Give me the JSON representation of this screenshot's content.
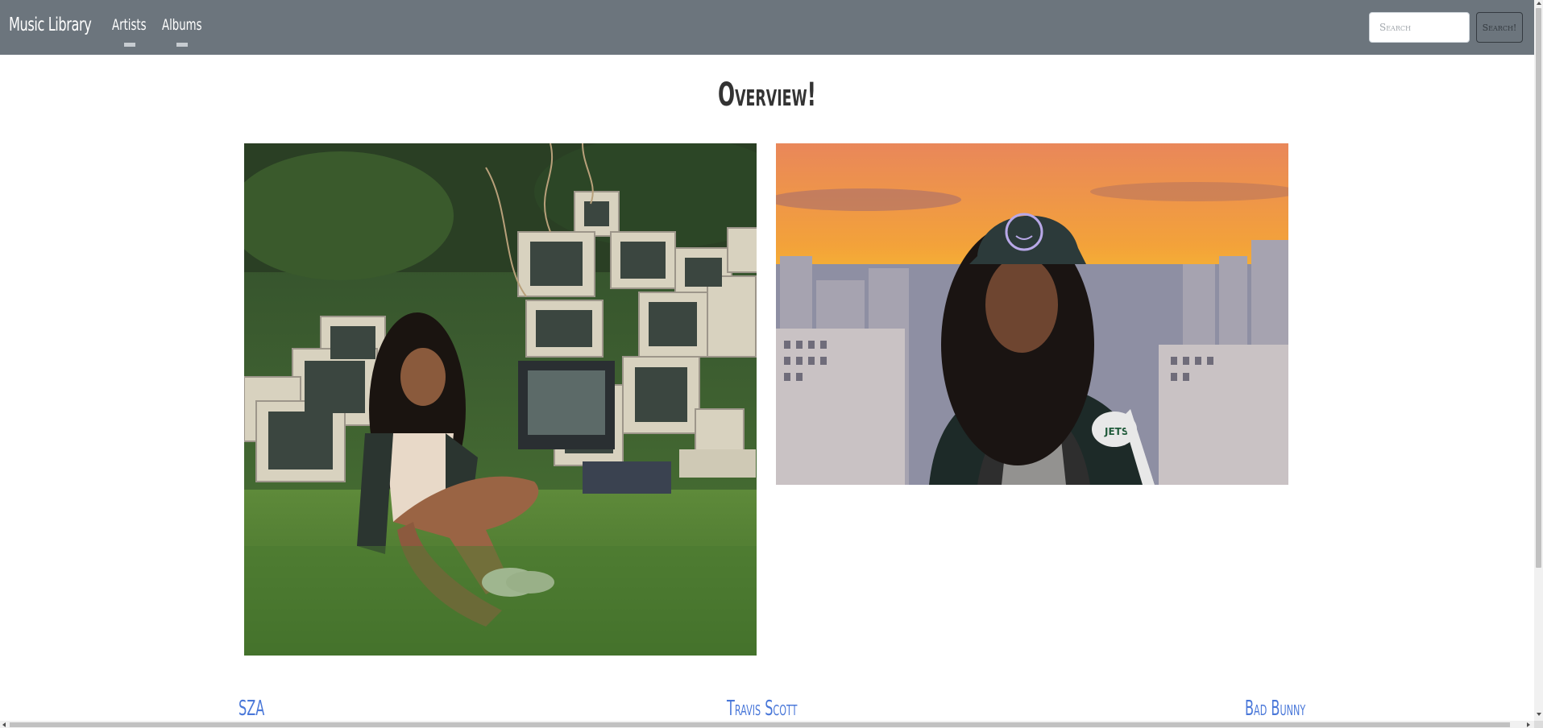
{
  "navbar": {
    "brand": "Music Library",
    "links": [
      {
        "label": "Artists"
      },
      {
        "label": "Albums"
      }
    ],
    "search": {
      "placeholder": "Search",
      "button_label": "Search!"
    }
  },
  "main": {
    "title": "Overview!",
    "photos": [
      {
        "description_icon": "artist-photo-icon"
      },
      {
        "description_icon": "artist-photo-icon"
      }
    ],
    "artists": [
      {
        "name": "SZA"
      },
      {
        "name": "Travis Scott"
      },
      {
        "name": "Bad Bunny"
      }
    ]
  },
  "colors": {
    "navbar_bg": "#6c757d",
    "link": "#4a78d9",
    "text": "#333333"
  }
}
